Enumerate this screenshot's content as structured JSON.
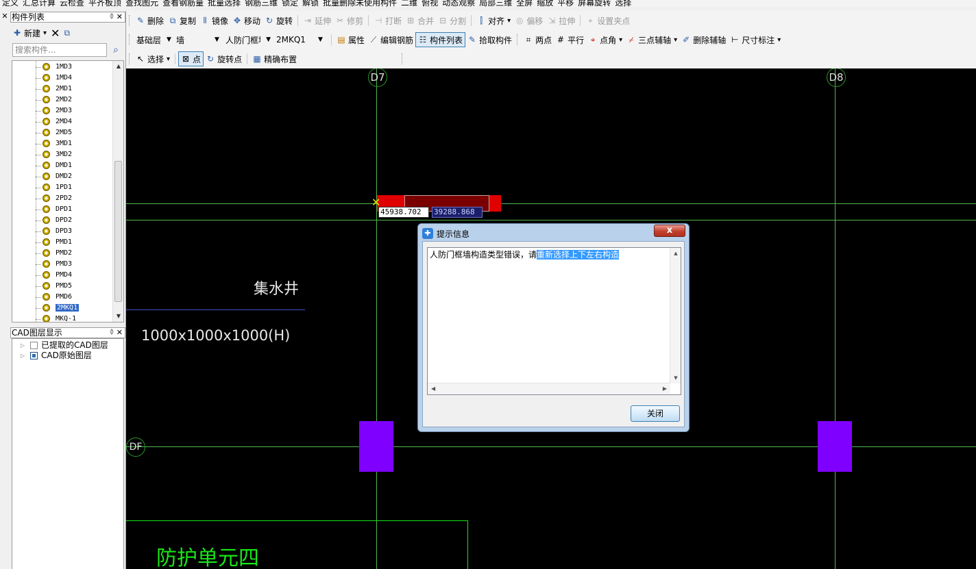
{
  "toolbar_row0": [
    "定义",
    "汇总计算",
    "云检查",
    "平齐板顶",
    "查找图元",
    "查看钢筋量",
    "批量选择",
    "钢筋三维",
    "锁定",
    "解锁",
    "批量删除未使用构件",
    "二维",
    "俯视",
    "动态观察",
    "局部三维",
    "全屏",
    "缩放",
    "平移",
    "屏幕旋转",
    "选择"
  ],
  "toolbar_row1": {
    "items": [
      {
        "label": "删除",
        "icon": "pencil-icon",
        "disabled": false
      },
      {
        "label": "复制",
        "icon": "copy-icon",
        "disabled": false
      },
      {
        "label": "镜像",
        "icon": "mirror-icon",
        "disabled": false
      },
      {
        "label": "移动",
        "icon": "move-icon",
        "disabled": false
      },
      {
        "label": "旋转",
        "icon": "rotate-icon",
        "disabled": false
      },
      {
        "label": "延伸",
        "icon": "extend-icon",
        "disabled": true
      },
      {
        "label": "修剪",
        "icon": "trim-icon",
        "disabled": true
      },
      {
        "label": "打断",
        "icon": "break-icon",
        "disabled": true
      },
      {
        "label": "合并",
        "icon": "merge-icon",
        "disabled": true
      },
      {
        "label": "分割",
        "icon": "split-icon",
        "disabled": true
      },
      {
        "label": "对齐",
        "icon": "align-icon",
        "disabled": false
      },
      {
        "label": "偏移",
        "icon": "offset-icon",
        "disabled": true
      },
      {
        "label": "拉伸",
        "icon": "stretch-icon",
        "disabled": true
      },
      {
        "label": "设置夹点",
        "icon": "grip-point-icon",
        "disabled": true
      }
    ]
  },
  "toolbar_row2": {
    "floor": "基础层",
    "type": "墙",
    "subtype": "人防门框墙",
    "component": "2MKQ1",
    "property_label": "属性",
    "edit_rebar_label": "编辑钢筋",
    "component_list_label": "构件列表",
    "pick_component_label": "拾取构件",
    "two_point_label": "两点",
    "parallel_label": "平行",
    "point_angle_label": "点角",
    "three_point_axis_label": "三点辅轴",
    "delete_axis_label": "删除辅轴",
    "dimension_label": "尺寸标注"
  },
  "toolbar_row3": {
    "select_label": "选择",
    "point_label": "点",
    "rotate_point_label": "旋转点",
    "precise_layout_label": "精确布置"
  },
  "component_panel": {
    "title": "构件列表",
    "new_label": "新建",
    "search_placeholder": "搜索构件...",
    "items": [
      "1MD3",
      "1MD4",
      "2MD1",
      "2MD2",
      "2MD3",
      "2MD4",
      "2MD5",
      "3MD1",
      "3MD2",
      "DMD1",
      "DMD2",
      "1PD1",
      "2PD2",
      "DPD1",
      "DPD2",
      "DPD3",
      "PMD1",
      "PMD2",
      "PMD3",
      "PMD4",
      "PMD5",
      "PMD6",
      "2MKQ1",
      "MKQ-1"
    ],
    "selected": "2MKQ1"
  },
  "cad_panel": {
    "title": "CAD图层显示",
    "layers": [
      {
        "label": "已提取的CAD图层"
      },
      {
        "label": "CAD原始图层"
      }
    ]
  },
  "canvas": {
    "axis_d7": "D7",
    "axis_d8": "D8",
    "axis_df": "DF",
    "sump_label": "集水井",
    "sump_size": "1000x1000x1000(H)",
    "unit_label": "防护单元四",
    "coord_x": "45938.702",
    "coord_y": "39288.868",
    "colors": {
      "background": "#000000",
      "grid": "#4fb84f",
      "wall_red": "#e00000",
      "column_purple": "#8000ff",
      "green_text": "#19e619"
    }
  },
  "dialog": {
    "title": "提示信息",
    "message_plain": "人防门框墙构造类型错误，请",
    "message_selected": "重新选择上下左右构造",
    "close_button": "关闭",
    "close_x": "x"
  }
}
